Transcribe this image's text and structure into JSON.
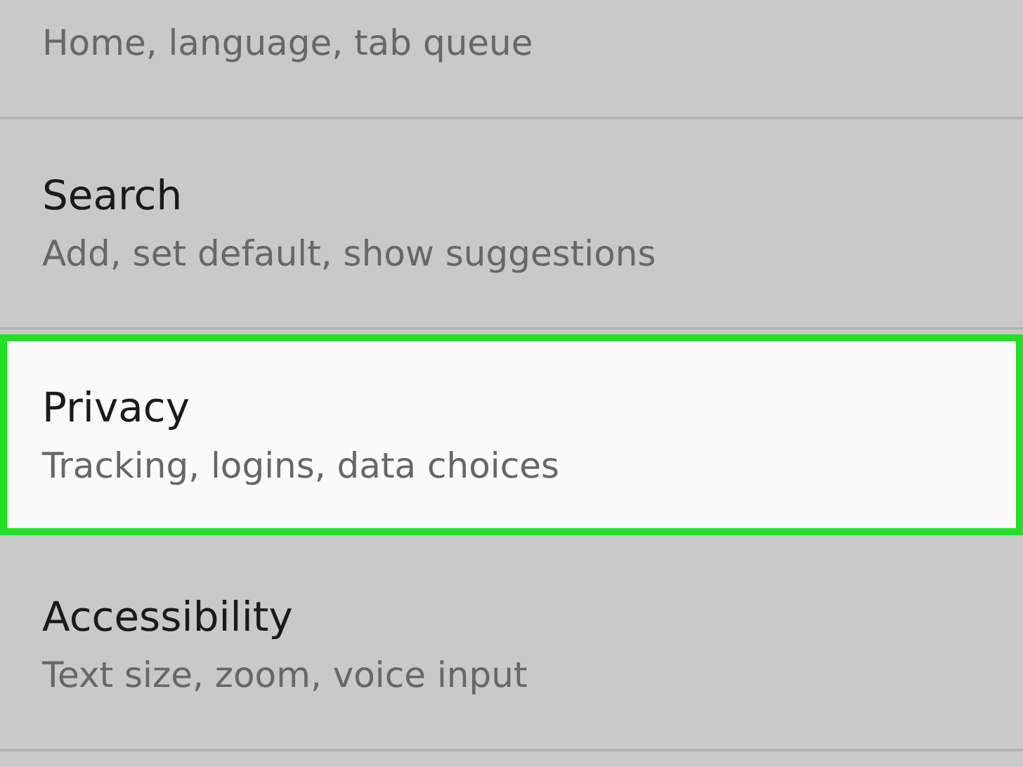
{
  "settings": [
    {
      "subtitle": "Home, language, tab queue",
      "selected": false
    },
    {
      "title": "Search",
      "subtitle": "Add, set default, show suggestions",
      "selected": false
    },
    {
      "title": "Privacy",
      "subtitle": "Tracking, logins, data choices",
      "selected": true
    },
    {
      "title": "Accessibility",
      "subtitle": "Text size, zoom, voice input",
      "selected": false
    }
  ]
}
